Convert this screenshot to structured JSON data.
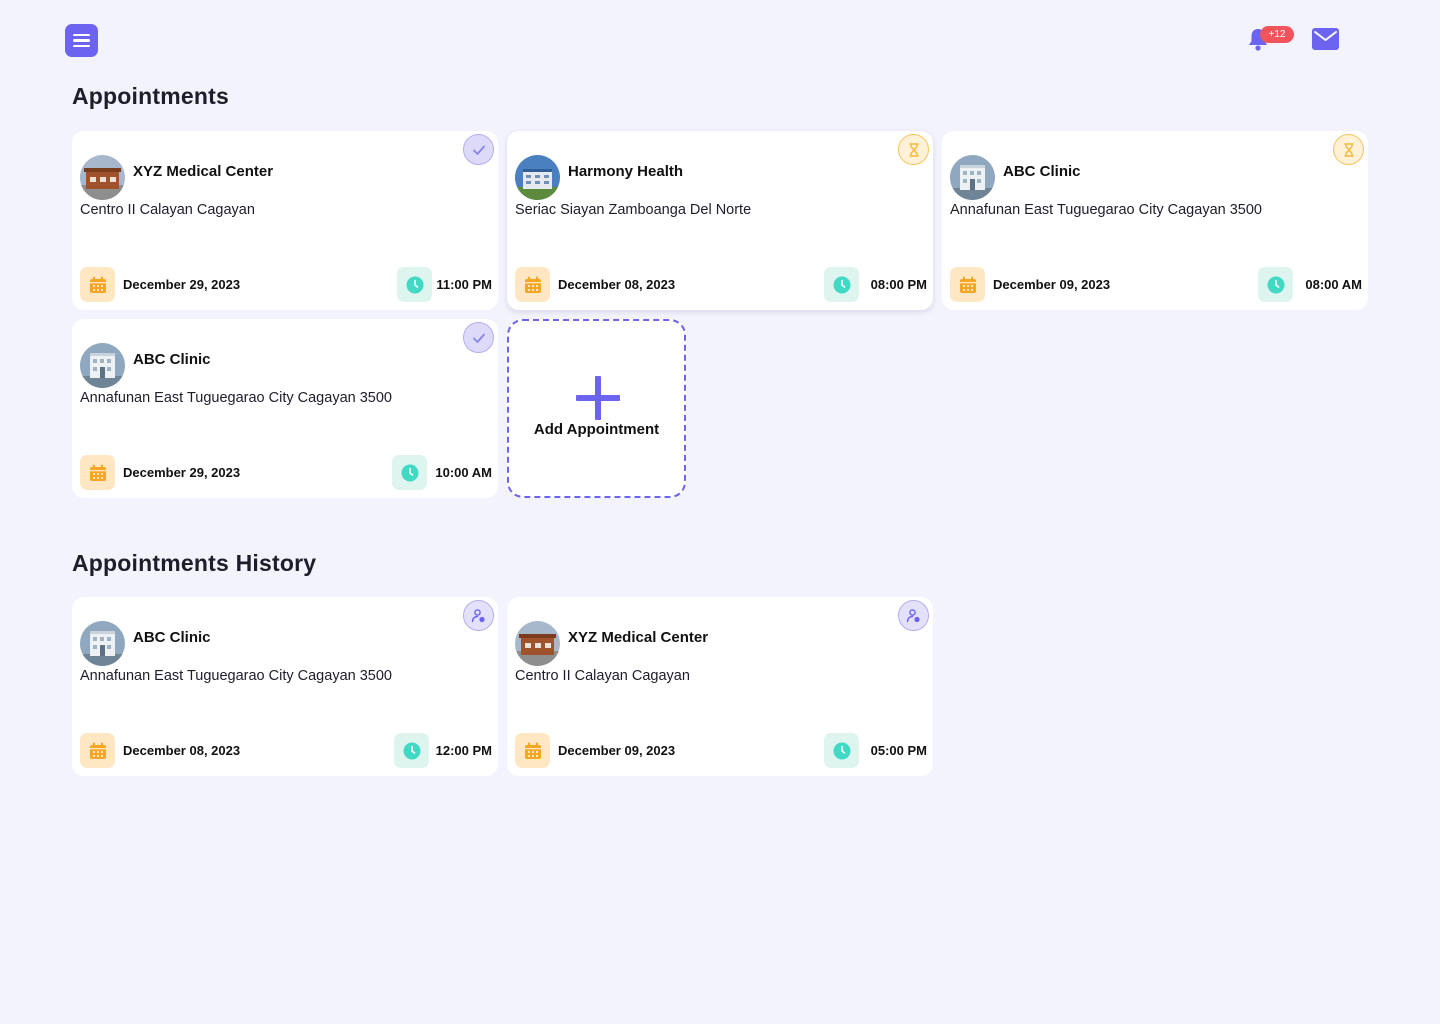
{
  "header": {
    "menu_icon": "hamburger-menu-icon",
    "bell_icon": "bell-icon",
    "notification_count": "+12",
    "mail_icon": "mail-icon"
  },
  "colors": {
    "accent": "#6C63F0",
    "background": "#F3F3FD",
    "badge": "#F2545B",
    "pending": "#F6B93B",
    "date_icon": "#F6A623",
    "time_icon": "#41D9C3"
  },
  "appointments": {
    "title": "Appointments",
    "cards": [
      {
        "name": "XYZ Medical Center",
        "address": "Centro II Calayan Cagayan",
        "date": "December 29, 2023",
        "time": "11:00 PM",
        "status": "confirmed-check-icon",
        "image": "brick-hospital"
      },
      {
        "name": "Harmony Health",
        "address": "Seriac Siayan Zamboanga Del Norte",
        "date": "December 08, 2023",
        "time": "08:00 PM",
        "status": "pending-hourglass-icon",
        "image": "modern-hospital"
      },
      {
        "name": "ABC Clinic",
        "address": "Annafunan East Tuguegarao City Cagayan 3500",
        "date": "December 09, 2023",
        "time": "08:00 AM",
        "status": "pending-hourglass-icon",
        "image": "white-clinic"
      },
      {
        "name": "ABC Clinic",
        "address": "Annafunan East Tuguegarao City Cagayan 3500",
        "date": "December 29, 2023",
        "time": "10:00 AM",
        "status": "confirmed-check-icon",
        "image": "white-clinic"
      }
    ],
    "add_label": "Add Appointment"
  },
  "history": {
    "title": "Appointments History",
    "cards": [
      {
        "name": "ABC Clinic",
        "address": "Annafunan East Tuguegarao City Cagayan 3500",
        "date": "December 08, 2023",
        "time": "12:00 PM",
        "status": "visited-person-icon",
        "image": "white-clinic"
      },
      {
        "name": "XYZ Medical Center",
        "address": "Centro II Calayan Cagayan",
        "date": "December 09, 2023",
        "time": "05:00 PM",
        "status": "visited-person-icon",
        "image": "brick-hospital"
      }
    ]
  }
}
